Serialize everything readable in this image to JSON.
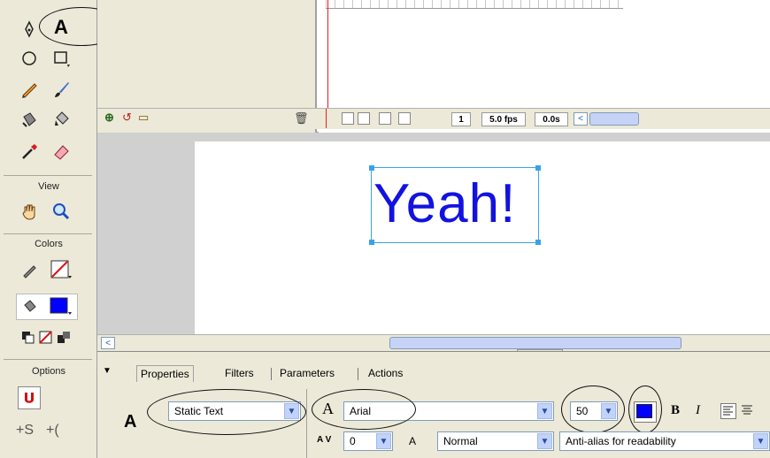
{
  "tools": {
    "text_tool_letter": "A",
    "view_label": "View",
    "colors_label": "Colors",
    "options_label": "Options",
    "stroke_color": "#e01010",
    "fill_color": "#0000ff"
  },
  "timeline": {
    "frame_number": "1",
    "fps": "5.0 fps",
    "elapsed": "0.0s"
  },
  "stage": {
    "text": "Yeah!",
    "text_color": "#1212e0"
  },
  "properties": {
    "tabs": [
      "Properties",
      "Filters",
      "Parameters",
      "Actions"
    ],
    "text_type": "Static Text",
    "font": "Arial",
    "font_size": "50",
    "text_color": "#0000ff",
    "letter_spacing": "0",
    "baseline": "Normal",
    "antialias": "Anti-alias for readability",
    "bold_label": "B",
    "italic_label": "I",
    "text_tool_letter": "A",
    "font_icon_letter": "A",
    "spacing_icon": "A V",
    "baseline_icon": "A"
  }
}
